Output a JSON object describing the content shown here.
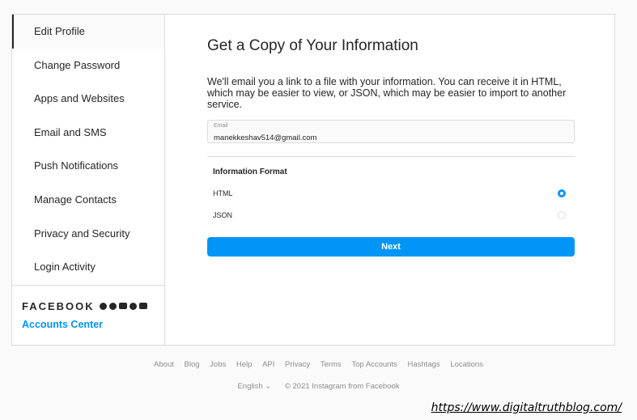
{
  "sidebar": {
    "items": [
      {
        "label": "Edit Profile"
      },
      {
        "label": "Change Password"
      },
      {
        "label": "Apps and Websites"
      },
      {
        "label": "Email and SMS"
      },
      {
        "label": "Push Notifications"
      },
      {
        "label": "Manage Contacts"
      },
      {
        "label": "Privacy and Security"
      },
      {
        "label": "Login Activity"
      }
    ],
    "brand": "FACEBOOK",
    "accounts_center": "Accounts Center"
  },
  "main": {
    "title": "Get a Copy of Your Information",
    "description": "We'll email you a link to a file with your information. You can receive it in HTML, which may be easier to view, or JSON, which may be easier to import to another service.",
    "email_label": "Email",
    "email_value": "manekkeshav514@gmail.com",
    "format_title": "Information Format",
    "options": [
      {
        "label": "HTML",
        "selected": true
      },
      {
        "label": "JSON",
        "selected": false
      }
    ],
    "next_label": "Next"
  },
  "footer": {
    "links": [
      "About",
      "Blog",
      "Jobs",
      "Help",
      "API",
      "Privacy",
      "Terms",
      "Top Accounts",
      "Hashtags",
      "Locations"
    ],
    "language": "English ⌄",
    "copyright": "© 2021 Instagram from Facebook"
  },
  "watermark": "https://www.digitaltruthblog.com/",
  "colors": {
    "accent": "#0095f6",
    "border": "#dbdbdb",
    "text": "#262626",
    "muted": "#8e8e8e"
  }
}
